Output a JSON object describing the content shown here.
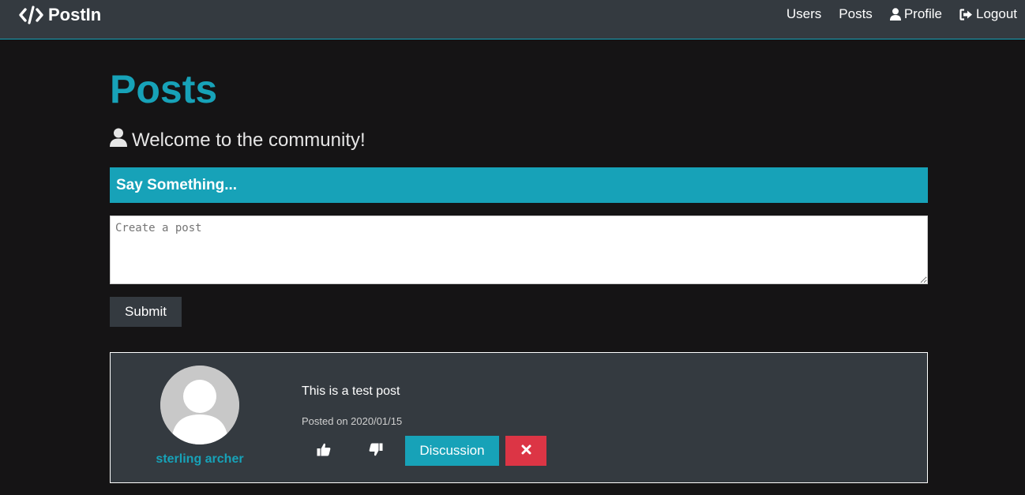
{
  "navbar": {
    "brand": "PostIn",
    "links": [
      {
        "label": "Users"
      },
      {
        "label": "Posts"
      },
      {
        "label": "Profile",
        "icon": "user-icon"
      },
      {
        "label": "Logout",
        "icon": "sign-out-icon"
      }
    ]
  },
  "main": {
    "title": "Posts",
    "lead": "Welcome to the community!",
    "form_header": "Say Something...",
    "textarea_placeholder": "Create a post",
    "submit_label": "Submit"
  },
  "post": {
    "author": "sterling archer",
    "text": "This is a test post",
    "date_line": "Posted on 2020/01/15",
    "discussion_label": "Discussion"
  },
  "colors": {
    "accent": "#17a2b8",
    "dark": "#343a40",
    "danger": "#dc3545",
    "background": "#151415"
  }
}
